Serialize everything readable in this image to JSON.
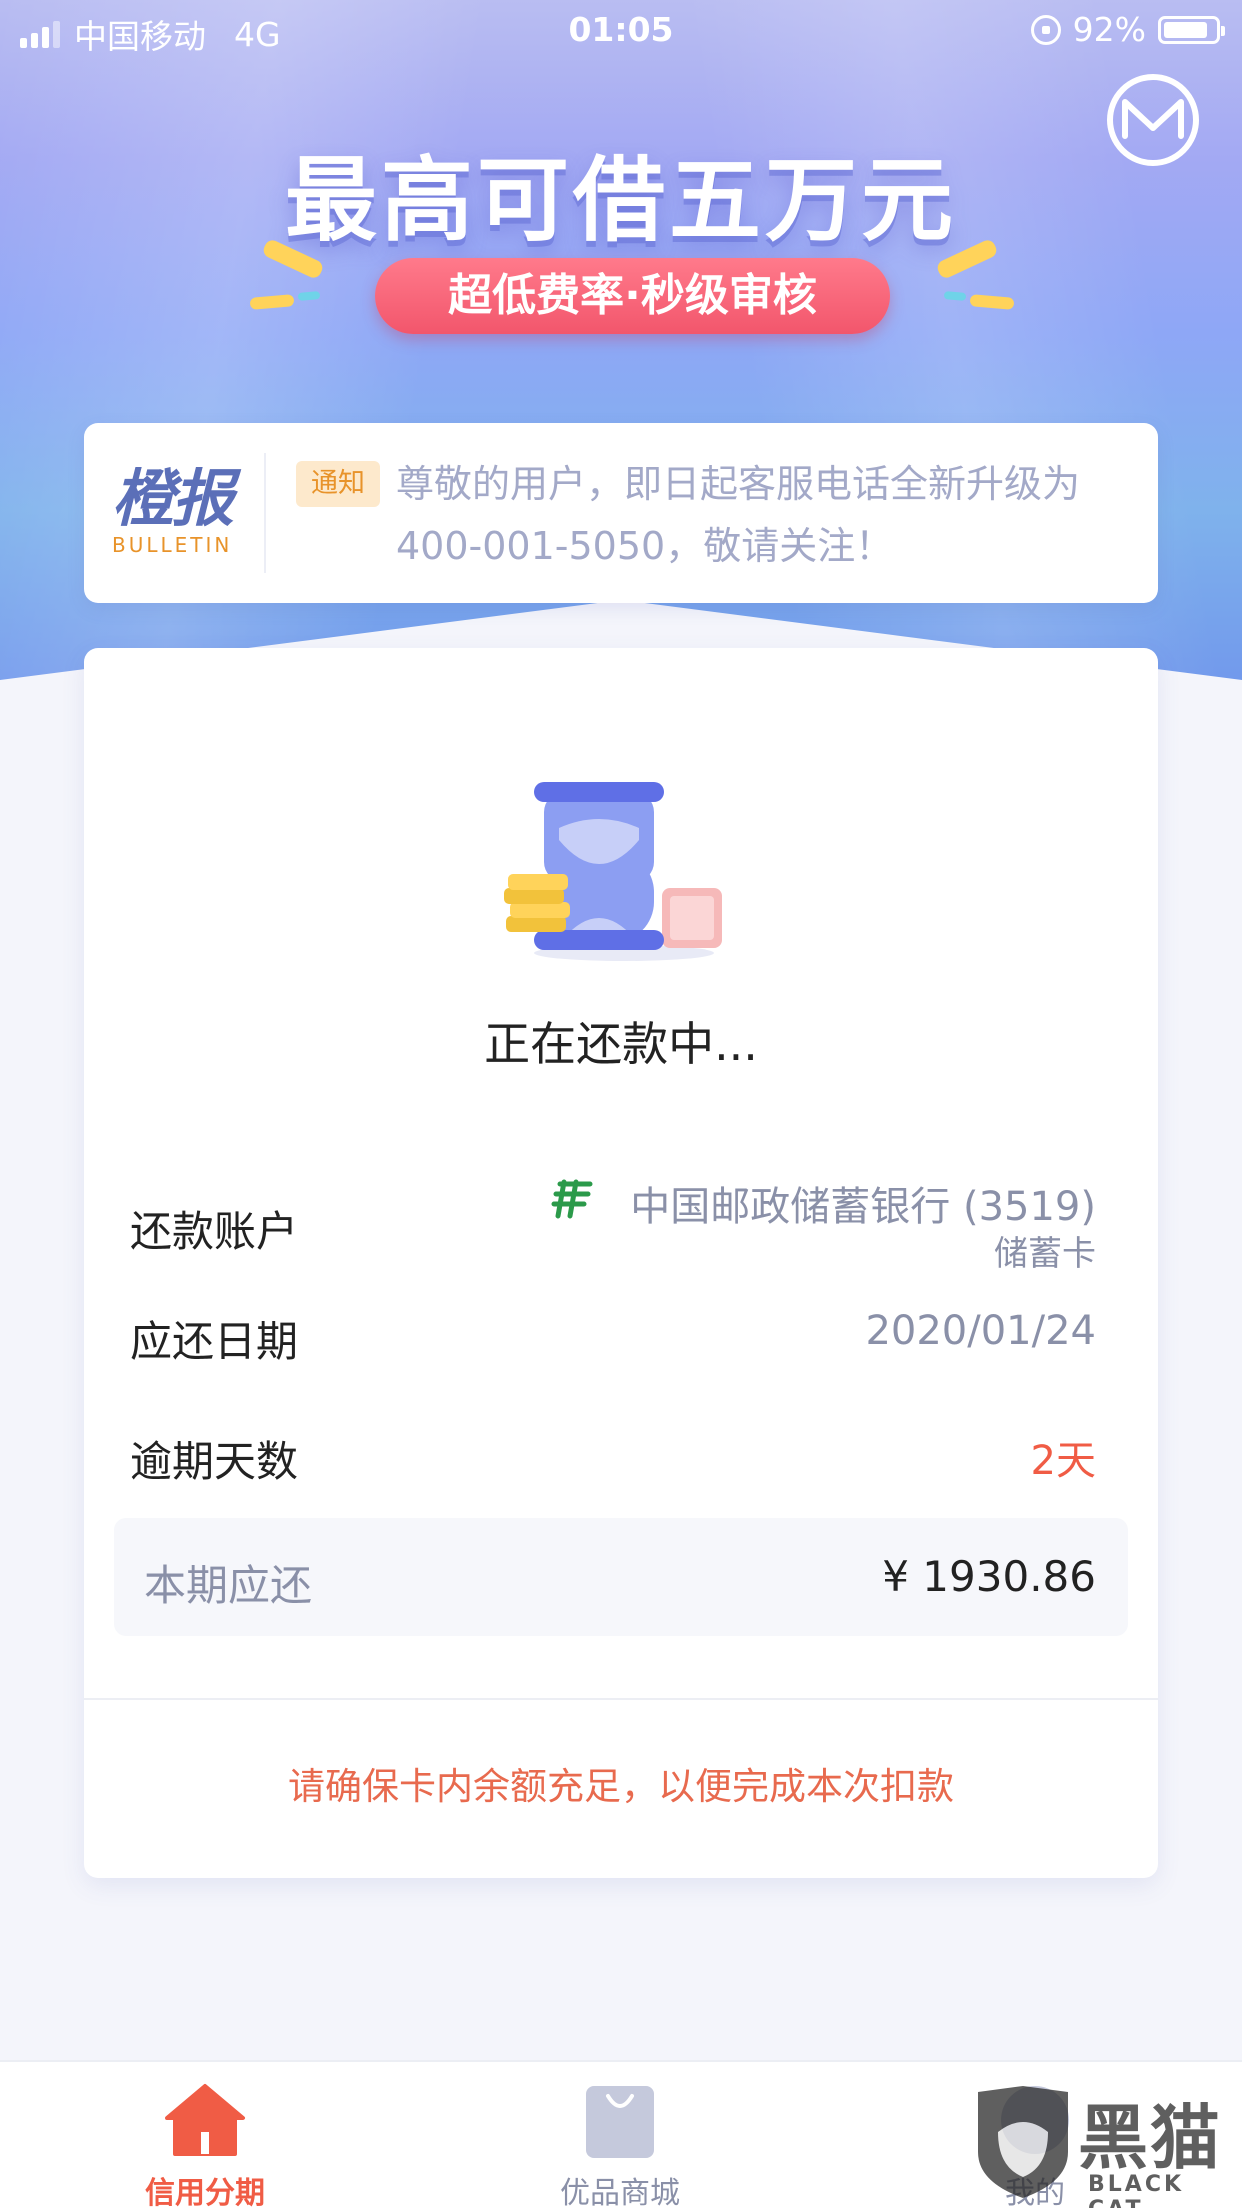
{
  "status_bar": {
    "carrier": "中国移动",
    "network": "4G",
    "time": "01:05",
    "battery": "92%"
  },
  "banner": {
    "title": "最高可借五万元",
    "subtitle": "超低费率·秒级审核"
  },
  "bulletin": {
    "logo_cn": "橙报",
    "logo_en": "BULLETIN",
    "tag": "通知",
    "text": "尊敬的用户，即日起客服电话全新升级为 400-001-5050，敬请关注！"
  },
  "repayment": {
    "status": "正在还款中...",
    "account_label": "还款账户",
    "account_bank": "中国邮政储蓄银行 (3519)",
    "account_type": "储蓄卡",
    "due_date_label": "应还日期",
    "due_date": "2020/01/24",
    "overdue_label": "逾期天数",
    "overdue_days": "2天",
    "amount_label": "本期应还",
    "amount": "¥ 1930.86",
    "warning": "请确保卡内余额充足，以便完成本次扣款"
  },
  "tabs": [
    {
      "label": "信用分期",
      "icon": "home-icon",
      "active": true
    },
    {
      "label": "优品商城",
      "icon": "shopping-bag-icon",
      "active": false
    },
    {
      "label": "我的",
      "icon": "profile-icon",
      "active": false
    }
  ],
  "watermark": {
    "cn": "黑猫",
    "en": "BLACK CAT"
  },
  "colors": {
    "accent_red": "#f05c45",
    "warning": "#e86a4e",
    "bulletin_orange": "#e8932a",
    "hero_purple": "#8ea7f6"
  }
}
